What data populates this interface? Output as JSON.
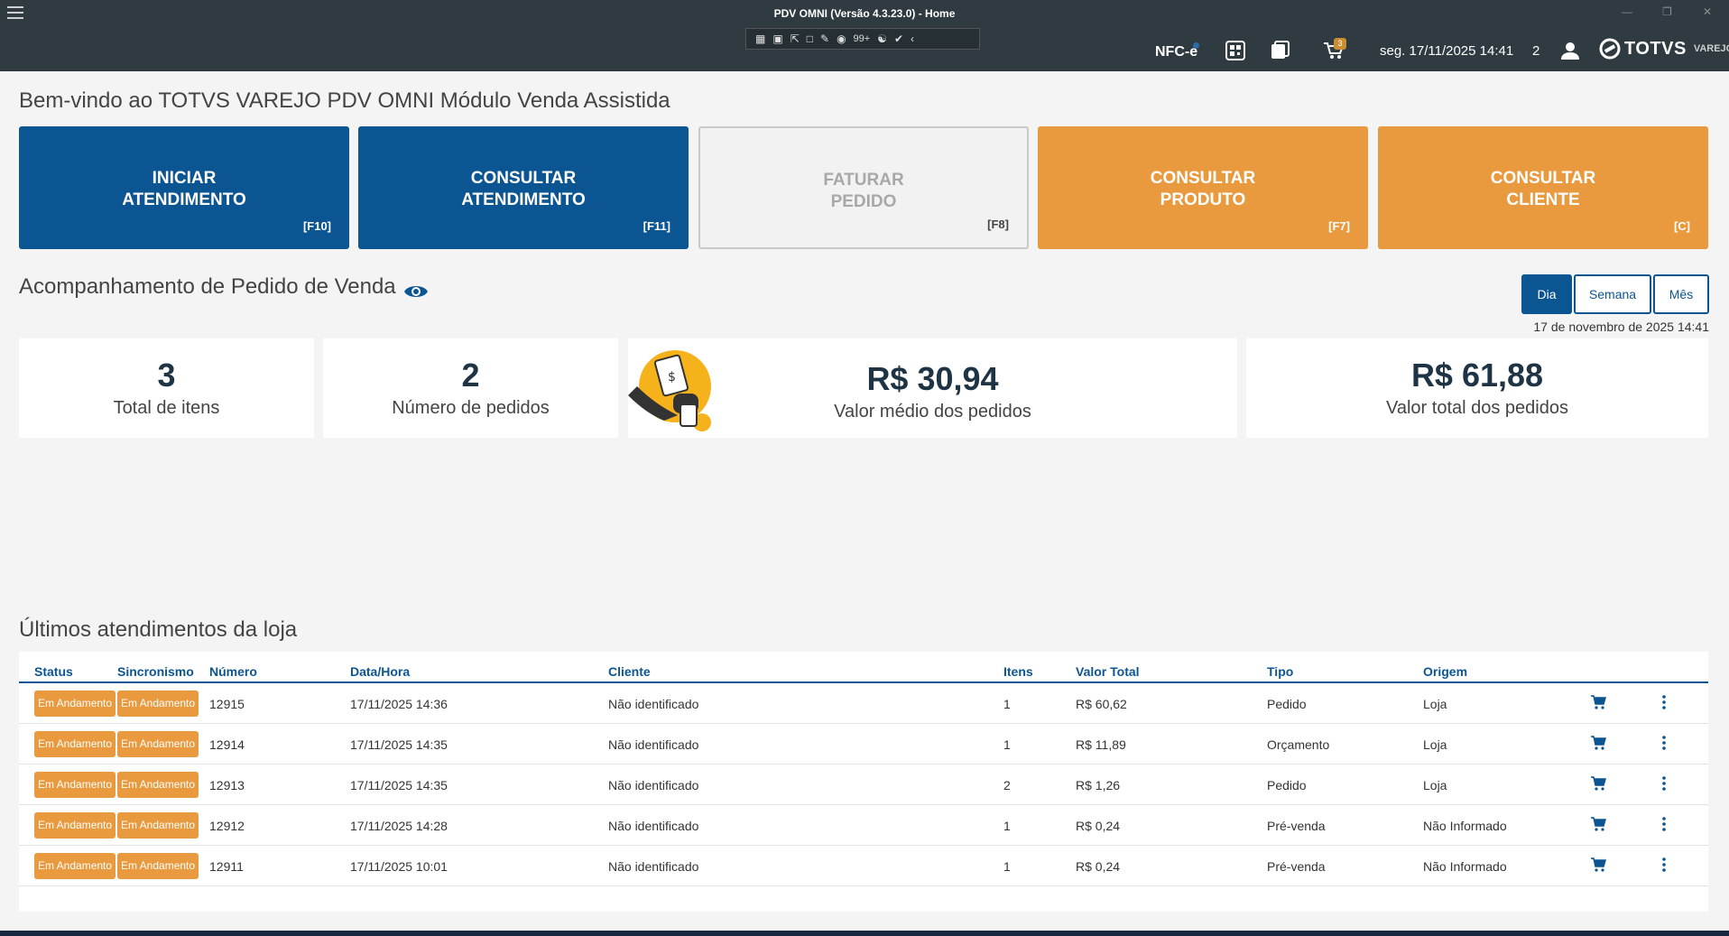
{
  "window": {
    "title": "PDV OMNI (Versão 4.3.23.0) - Home",
    "toolbar_count": "99+",
    "nfce_label": "NFC-e",
    "cart_count": "3",
    "datetime": "seg. 17/11/2025 14:41",
    "user_count": "2",
    "brand": "TOTVS",
    "brand_sub": "VAREJO"
  },
  "welcome": "Bem-vindo ao TOTVS VAREJO PDV OMNI Módulo Venda Assistida",
  "tiles": [
    {
      "label": "INICIAR\nATENDIMENTO",
      "key": "[F10]"
    },
    {
      "label": "CONSULTAR\nATENDIMENTO",
      "key": "[F11]"
    },
    {
      "label": "FATURAR\nPEDIDO",
      "key": "[F8]"
    },
    {
      "label": "CONSULTAR\nPRODUTO",
      "key": "[F7]"
    },
    {
      "label": "CONSULTAR\nCLIENTE",
      "key": "[C]"
    }
  ],
  "tracking": {
    "title": "Acompanhamento de Pedido de Venda",
    "periods": [
      "Dia",
      "Semana",
      "Mês"
    ],
    "active_period": "Dia",
    "date": "17 de novembro de 2025 14:41"
  },
  "kpis": [
    {
      "value": "3",
      "caption": "Total de itens"
    },
    {
      "value": "2",
      "caption": "Número de pedidos"
    },
    {
      "value": "R$ 30,94",
      "caption": "Valor médio dos pedidos"
    },
    {
      "value": "R$ 61,88",
      "caption": "Valor total dos pedidos"
    }
  ],
  "recent": {
    "title": "Últimos atendimentos da loja",
    "columns": [
      "Status",
      "Sincronismo",
      "Número",
      "Data/Hora",
      "Cliente",
      "Itens",
      "Valor Total",
      "Tipo",
      "Origem"
    ],
    "rows": [
      {
        "status": "Em Andamento",
        "sync": "Em Andamento",
        "numero": "12915",
        "datahora": "17/11/2025 14:36",
        "cliente": "Não identificado",
        "itens": "1",
        "valor": "R$ 60,62",
        "tipo": "Pedido",
        "origem": "Loja"
      },
      {
        "status": "Em Andamento",
        "sync": "Em Andamento",
        "numero": "12914",
        "datahora": "17/11/2025 14:35",
        "cliente": "Não identificado",
        "itens": "1",
        "valor": "R$ 11,89",
        "tipo": "Orçamento",
        "origem": "Loja"
      },
      {
        "status": "Em Andamento",
        "sync": "Em Andamento",
        "numero": "12913",
        "datahora": "17/11/2025 14:35",
        "cliente": "Não identificado",
        "itens": "2",
        "valor": "R$ 1,26",
        "tipo": "Pedido",
        "origem": "Loja"
      },
      {
        "status": "Em Andamento",
        "sync": "Em Andamento",
        "numero": "12912",
        "datahora": "17/11/2025 14:28",
        "cliente": "Não identificado",
        "itens": "1",
        "valor": "R$ 0,24",
        "tipo": "Pré-venda",
        "origem": "Não Informado"
      },
      {
        "status": "Em Andamento",
        "sync": "Em Andamento",
        "numero": "12911",
        "datahora": "17/11/2025 10:01",
        "cliente": "Não identificado",
        "itens": "1",
        "valor": "R$ 0,24",
        "tipo": "Pré-venda",
        "origem": "Não Informado"
      }
    ]
  },
  "colors": {
    "primary": "#0b5592",
    "accent": "#e99a3e",
    "titlebar": "#2f3b40"
  }
}
